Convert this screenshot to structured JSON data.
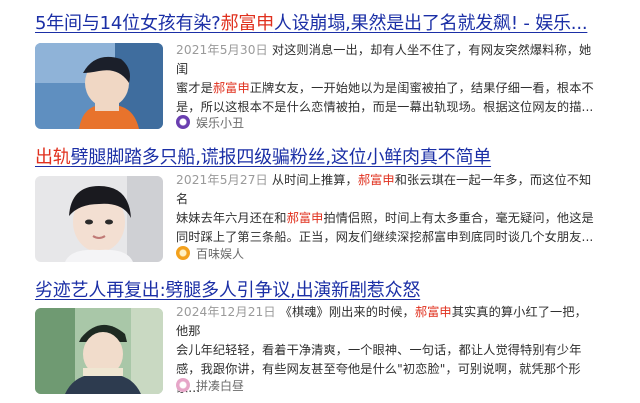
{
  "results": [
    {
      "title_pre": "5年间与14位女孩有染?",
      "title_hl": "郝富申",
      "title_post": "人设崩塌,果然是出了名就发飙! - 娱乐...",
      "date": "2021年5月30日",
      "lines": [
        {
          "pre": "对这则消息一出，却有人坐不住了，有网友突然爆料称，她闺",
          "hl": "",
          "post": ""
        },
        {
          "pre": "蜜才是",
          "hl": "郝富申",
          "post": "正牌女友，一开始她以为是闺蜜被拍了，结果仔细一看，根本不"
        },
        {
          "pre": "是，所以这根本不是什么恋情被拍，而是一幕出轨现场。根据这位网友的描...",
          "hl": "",
          "post": ""
        }
      ],
      "source": "娱乐小丑",
      "source_icon": "purple-circle-icon"
    },
    {
      "title_pre": "",
      "title_hl": "出轨",
      "title_post": "劈腿脚踏多只船,谎报四级骗粉丝,这位小鲜肉真不简单",
      "date": "2021年5月27日",
      "lines": [
        {
          "pre": "从时间上推算，",
          "hl": "郝富申",
          "post": "和张云琪在一起一年多，而这位不知名"
        },
        {
          "pre": "妹妹去年六月还在和",
          "hl": "郝富申",
          "post": "拍情侣照，时间上有太多重合，毫无疑问，他这是"
        },
        {
          "pre": "同时踩上了第三条船。正当，网友们继续深挖郝富申到底同时谈几个女朋友...",
          "hl": "",
          "post": ""
        }
      ],
      "source": "百味娱人",
      "source_icon": "orange-circle-icon"
    },
    {
      "title_pre": "劣迹艺人再复出:劈腿多人引争议,出演新剧惹众怒",
      "title_hl": "",
      "title_post": "",
      "date": "2024年12月21日",
      "lines": [
        {
          "pre": "《棋魂》刚出来的时候，",
          "hl": "郝富申",
          "post": "其实真的算小红了一把，他那"
        },
        {
          "pre": "会儿年纪轻轻，看着干净清爽，一个眼神、一句话，都让人觉得特别有少年",
          "hl": "",
          "post": ""
        },
        {
          "pre": "感，我跟你讲，有些网友甚至夸他是什么\"初恋脸\"，可别说啊，就凭那个形象...",
          "hl": "",
          "post": ""
        }
      ],
      "source": "拼凑白昼",
      "source_icon": "pink-circle-icon"
    }
  ]
}
